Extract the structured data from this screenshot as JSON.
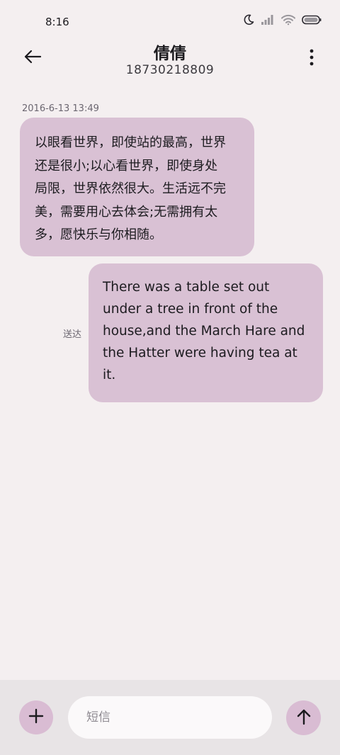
{
  "status_bar": {
    "time": "8:16",
    "icons": [
      "moon-icon",
      "signal-icon",
      "wifi-icon",
      "battery-icon"
    ]
  },
  "header": {
    "back_icon": "arrow-left-icon",
    "contact_name": "倩倩",
    "phone_number": "18730218809",
    "more_icon": "more-vertical-icon"
  },
  "conversation": {
    "timestamp": "2016-6-13 13:49",
    "messages": [
      {
        "direction": "incoming",
        "lines": [
          "以眼看世界，即使站的最高，世界",
          "还是很小;以心看世界，即使身处",
          "局限，世界依然很大。生活远不完",
          "美，需要用心去体会;无需拥有太",
          "多，愿快乐与你相随。"
        ]
      },
      {
        "direction": "outgoing",
        "status": "送达",
        "lines": [
          "There was a table set out",
          "under a tree in front of the",
          "house,and the March Hare and",
          "the Hatter were having tea at",
          "it."
        ]
      }
    ]
  },
  "composer": {
    "add_icon": "plus-icon",
    "placeholder": "短信",
    "value": "",
    "send_icon": "arrow-up-icon"
  },
  "colors": {
    "background": "#f4eff0",
    "bubble": "#d9c1d4",
    "accent_button": "#d9bcd3",
    "composer_bar": "#e8e4e6"
  }
}
